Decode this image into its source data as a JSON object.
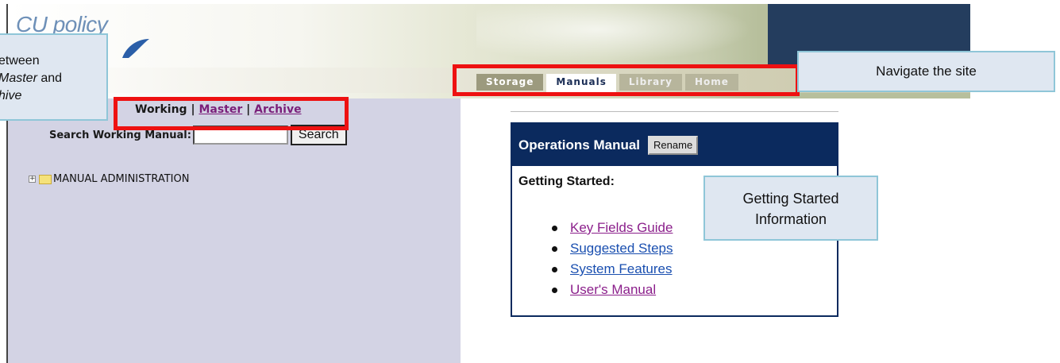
{
  "app": {
    "logo_text": "CU policy"
  },
  "nav": {
    "tabs": [
      {
        "label": "Storage"
      },
      {
        "label": "Manuals"
      },
      {
        "label": "Library"
      },
      {
        "label": "Home"
      }
    ],
    "active_tab": "Manuals"
  },
  "sidebar": {
    "view_current": "Working",
    "view_master": "Master",
    "view_archive": "Archive",
    "separator": "|",
    "search_label": "Search Working Manual:",
    "search_value": "",
    "search_button": "Search",
    "tree_toggle": "+",
    "tree_item": "MANUAL ADMINISTRATION"
  },
  "main": {
    "manual_title": "Operations Manual",
    "rename_button": "Rename",
    "section_title": "Getting Started:",
    "links": [
      {
        "label": "Key Fields Guide",
        "visited": true
      },
      {
        "label": "Suggested Steps",
        "visited": false
      },
      {
        "label": "System Features",
        "visited": false
      },
      {
        "label": "User's Manual",
        "visited": true
      }
    ]
  },
  "annotations": {
    "nav_callout": "Navigate the site",
    "getting_started_line1": "Getting Started",
    "getting_started_line2": "Information",
    "switch_line1": "etween",
    "switch_line2_italic": "Master",
    "switch_line2_rest": " and",
    "switch_line3_italic": "hive",
    "highlight_color": "#ee1111",
    "callout_bg": "#dfe7f1",
    "callout_border": "#8fc6d8"
  },
  "colors": {
    "nav_bg": "#9c9a7e",
    "panel_bg": "#d3d3e4",
    "header_navy": "#0b2a5e",
    "visited_link": "#8b1f8b",
    "link": "#1a4fb0"
  }
}
